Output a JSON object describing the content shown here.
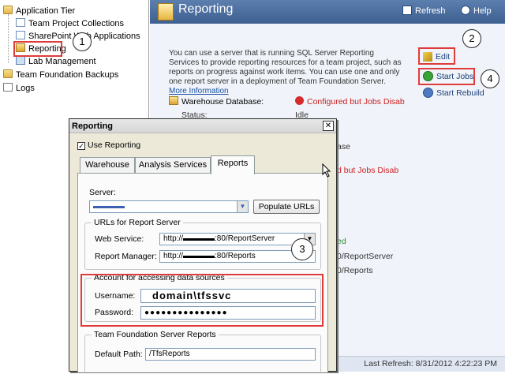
{
  "tree": {
    "items": [
      {
        "label": "Application Tier"
      },
      {
        "label": "Team Project Collections"
      },
      {
        "label": "SharePoint Web Applications"
      },
      {
        "label": "Reporting"
      },
      {
        "label": "Lab Management"
      },
      {
        "label": "Team Foundation Backups"
      },
      {
        "label": "Logs"
      }
    ]
  },
  "header": {
    "title": "Reporting",
    "refresh_label": "Refresh",
    "help_label": "Help"
  },
  "content": {
    "description": "You can use a server that is running SQL Server Reporting Services to provide reporting resources for a team project, such as reports on progress against work items. You can use one and only one report server in a deployment of Team Foundation Server.",
    "more_info_link": "More Information",
    "edit_label": "Edit",
    "start_jobs_label": "Start Jobs",
    "start_rebuild_label": "Start Rebuild",
    "warehouse_label": "Warehouse Database:",
    "warehouse_status": "Configured but Jobs Disab",
    "status_label": "Status:",
    "status_value": "Idle",
    "frag_ase": "ase",
    "frag_disab": "d but Jobs Disab",
    "frag_ed": "ed",
    "frag_reportserver": "0/ReportServer",
    "frag_reports": "0/Reports",
    "last_refresh": "Last Refresh: 8/31/2012 4:22:23 PM"
  },
  "dialog": {
    "title": "Reporting",
    "use_reporting_label": "Use Reporting",
    "tabs": [
      {
        "label": "Warehouse"
      },
      {
        "label": "Analysis Services"
      },
      {
        "label": "Reports"
      }
    ],
    "server_label": "Server:",
    "server_value": "▬▬▬▬",
    "populate_urls_label": "Populate URLs",
    "urls_group_title": "URLs for Report Server",
    "web_service_label": "Web Service:",
    "web_service_value": "http://▬▬▬▬:80/ReportServer",
    "report_manager_label": "Report Manager:",
    "report_manager_value": "http://▬▬▬▬:80/Reports",
    "account_group_title": "Account for accessing data sources",
    "username_label": "Username:",
    "username_value": "domain\\tfssvc",
    "password_label": "Password:",
    "password_value": "●●●●●●●●●●●●●●●",
    "tfs_reports_group_title": "Team Foundation Server Reports",
    "default_path_label": "Default Path:",
    "default_path_value": "/TfsReports"
  },
  "callouts": [
    "1",
    "2",
    "3",
    "4"
  ],
  "colors": {
    "header_bg": "#4a6d9f",
    "highlight_red": "#e03b3b",
    "error_red": "#cc1f1f",
    "success_green": "#2a8a2a"
  }
}
